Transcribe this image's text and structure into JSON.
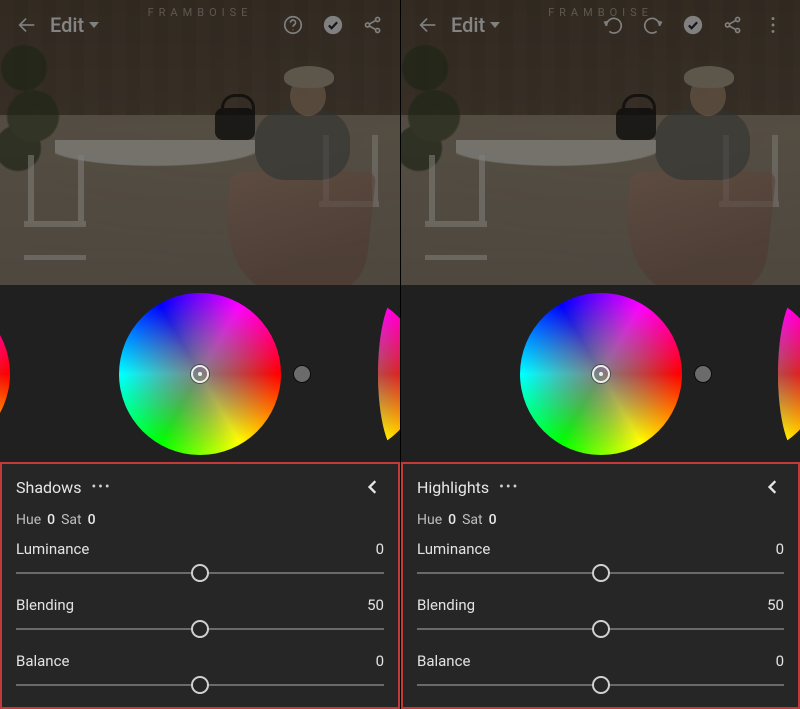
{
  "left": {
    "header": {
      "filename": "FRAMBOISE",
      "edit_label": "Edit"
    },
    "panel": {
      "title": "Shadows",
      "hue_label": "Hue",
      "hue_value": "0",
      "sat_label": "Sat",
      "sat_value": "0",
      "sliders": {
        "luminance": {
          "label": "Luminance",
          "value": "0",
          "percent": 50
        },
        "blending": {
          "label": "Blending",
          "value": "50",
          "percent": 50
        },
        "balance": {
          "label": "Balance",
          "value": "0",
          "percent": 50
        }
      }
    }
  },
  "right": {
    "header": {
      "filename": "FRAMBOISE",
      "edit_label": "Edit"
    },
    "panel": {
      "title": "Highlights",
      "hue_label": "Hue",
      "hue_value": "0",
      "sat_label": "Sat",
      "sat_value": "0",
      "sliders": {
        "luminance": {
          "label": "Luminance",
          "value": "0",
          "percent": 50
        },
        "blending": {
          "label": "Blending",
          "value": "50",
          "percent": 50
        },
        "balance": {
          "label": "Balance",
          "value": "0",
          "percent": 50
        }
      }
    }
  }
}
